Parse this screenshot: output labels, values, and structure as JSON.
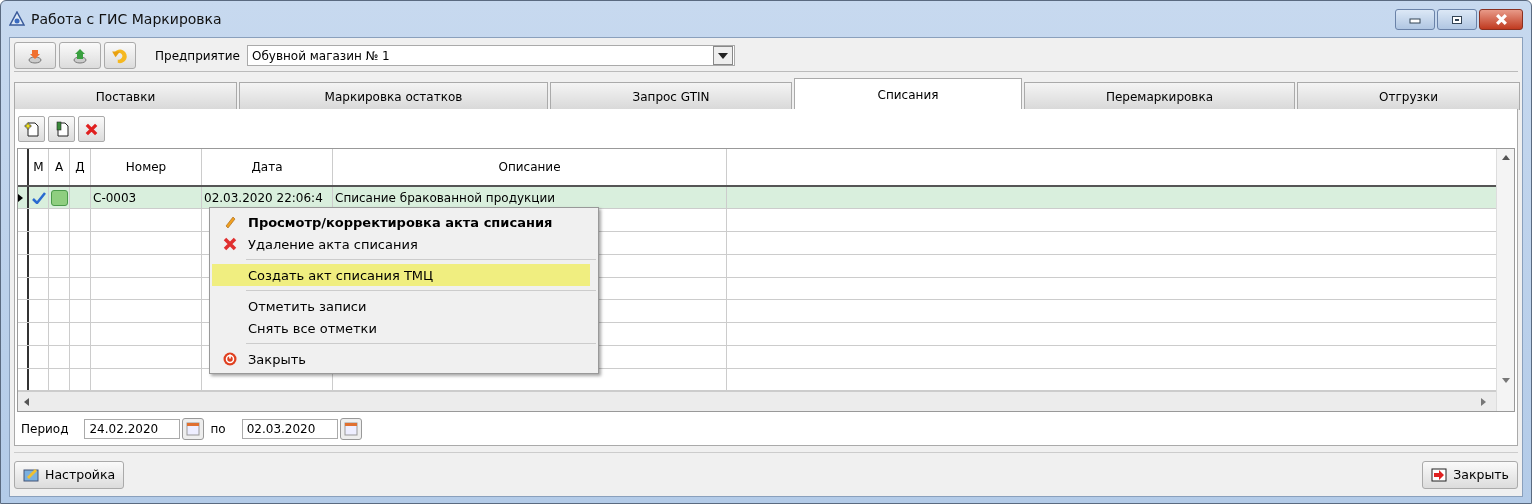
{
  "window": {
    "title": "Работа с ГИС Маркировка"
  },
  "enterprise": {
    "label": "Предприятие",
    "value": "Обувной магазин № 1"
  },
  "tabs": [
    {
      "label": "Поставки",
      "selected": false
    },
    {
      "label": "Маркировка остатков",
      "selected": false
    },
    {
      "label": "Запрос GTIN",
      "selected": false
    },
    {
      "label": "Списания",
      "selected": true
    },
    {
      "label": "Перемаркировка",
      "selected": false
    },
    {
      "label": "Отгрузки",
      "selected": false
    }
  ],
  "grid": {
    "columns": [
      "М",
      "А",
      "Д",
      "Номер",
      "Дата",
      "Описание"
    ],
    "rows": [
      {
        "selected": true,
        "marked": true,
        "a_flag": true,
        "number": "С-0003",
        "date": "02.03.2020 22:06:4",
        "description": "Списание бракованной продукции"
      }
    ]
  },
  "context_menu": {
    "groups": [
      [
        {
          "label": "Просмотр/корректировка акта списания",
          "default": true,
          "selected": false
        },
        {
          "label": "Удаление акта списания",
          "default": false,
          "selected": false
        }
      ],
      [
        {
          "label": "Создать акт списания ТМЦ",
          "default": false,
          "selected": true
        }
      ],
      [
        {
          "label": "Отметить записи",
          "default": false,
          "selected": false
        },
        {
          "label": "Снять все отметки",
          "default": false,
          "selected": false
        }
      ],
      [
        {
          "label": "Закрыть",
          "default": false,
          "selected": false
        }
      ]
    ]
  },
  "period": {
    "label": "Период",
    "from": "24.02.2020",
    "to_label": "по",
    "to": "02.03.2020"
  },
  "buttons": {
    "settings": "Настройка",
    "close": "Закрыть"
  }
}
